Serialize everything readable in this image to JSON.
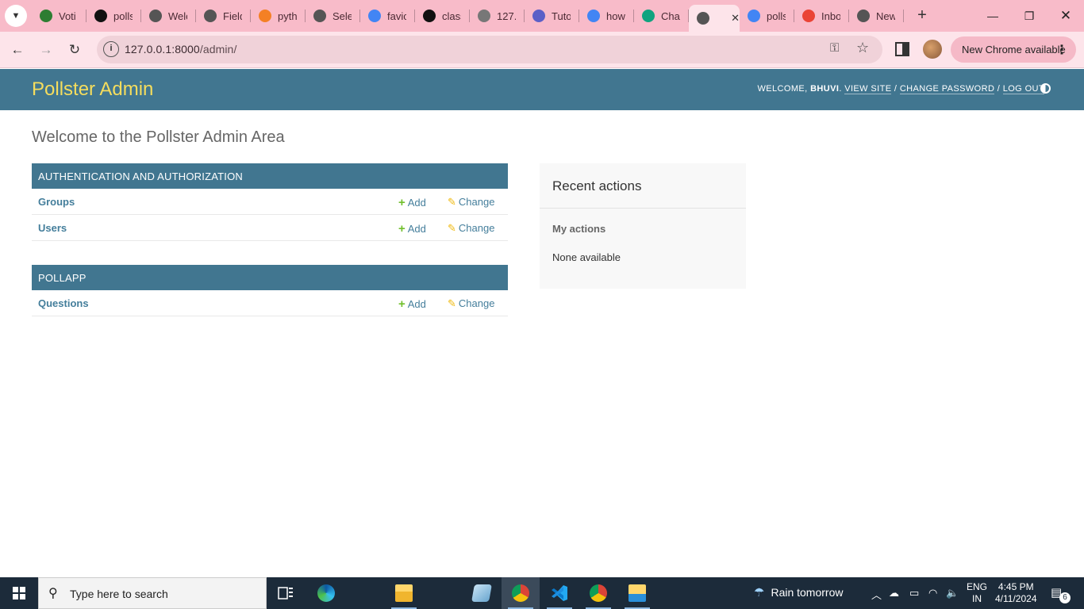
{
  "browser": {
    "tabs": [
      {
        "title": "Voti",
        "favicon": "voting-icon",
        "color": "#2e7d32"
      },
      {
        "title": "polls",
        "favicon": "github-icon",
        "color": "#111111"
      },
      {
        "title": "Welc",
        "favicon": "globe-icon",
        "color": "#555555"
      },
      {
        "title": "Field",
        "favicon": "globe-icon",
        "color": "#555555"
      },
      {
        "title": "pyth",
        "favicon": "stackoverflow-icon",
        "color": "#f48024"
      },
      {
        "title": "Sele",
        "favicon": "globe-icon",
        "color": "#555555"
      },
      {
        "title": "favic",
        "favicon": "google-icon",
        "color": "#4285f4"
      },
      {
        "title": "class",
        "favicon": "github-icon",
        "color": "#111111"
      },
      {
        "title": "127.",
        "favicon": "globe-icon",
        "color": "#777777"
      },
      {
        "title": "Tuto",
        "favicon": "teams-icon",
        "color": "#5b5fc7"
      },
      {
        "title": "how",
        "favicon": "google-icon",
        "color": "#4285f4"
      },
      {
        "title": "Chat",
        "favicon": "chatgpt-icon",
        "color": "#10a37f"
      },
      {
        "title": "",
        "favicon": "globe-icon",
        "color": "#555555",
        "active": true
      },
      {
        "title": "polls",
        "favicon": "google-icon",
        "color": "#4285f4"
      },
      {
        "title": "Inbo",
        "favicon": "gmail-icon",
        "color": "#ea4335"
      },
      {
        "title": "New",
        "favicon": "chrome-icon",
        "color": "#555555"
      }
    ],
    "url_host": "127.0.0.1:8000",
    "url_path": "/admin/",
    "update_button": "New Chrome available"
  },
  "admin": {
    "site_name": "Pollster Admin",
    "welcome": "Welcome,",
    "username": "Bhuvi",
    "view_site": "View site",
    "change_password": "Change password",
    "log_out": "Log out",
    "page_title": "Welcome to the Pollster Admin Area",
    "add_label": "Add",
    "change_label": "Change",
    "modules": [
      {
        "caption": "Authentication and Authorization",
        "rows": [
          "Groups",
          "Users"
        ]
      },
      {
        "caption": "Pollapp",
        "rows": [
          "Questions"
        ]
      }
    ],
    "recent": {
      "title": "Recent actions",
      "subtitle": "My actions",
      "empty": "None available"
    },
    "colors": {
      "header": "#417690",
      "brand": "#f5dd5d",
      "link": "#447e9b",
      "add": "#70bf2b",
      "change": "#efb80b"
    }
  },
  "taskbar": {
    "search_placeholder": "Type here to search",
    "weather": "Rain tomorrow",
    "lang_line1": "ENG",
    "lang_line2": "IN",
    "time": "4:45 PM",
    "date": "4/11/2024",
    "notification_count": "6"
  }
}
